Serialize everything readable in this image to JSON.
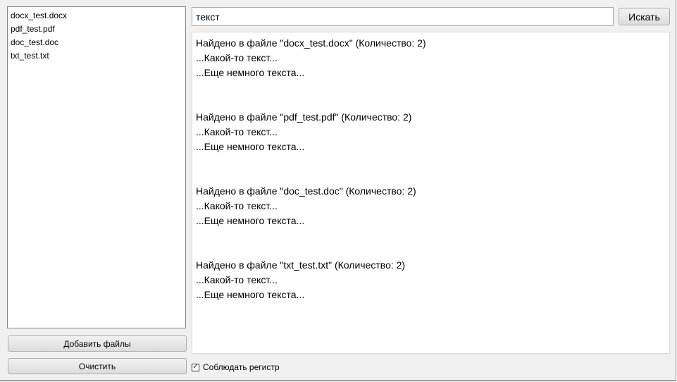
{
  "files": [
    "docx_test.docx",
    "pdf_test.pdf",
    "doc_test.doc",
    "txt_test.txt"
  ],
  "buttons": {
    "add_files": "Добавить файлы",
    "clear": "Очистить",
    "search": "Искать"
  },
  "search": {
    "value": "текст"
  },
  "case_checkbox": {
    "label": "Соблюдать регистр",
    "checked": true
  },
  "results": [
    {
      "header": "Найдено в файле \"docx_test.docx\" (Количество: 2)",
      "lines": [
        "...Какой-то текст...",
        "...Еще немного текста..."
      ]
    },
    {
      "header": "Найдено в файле \"pdf_test.pdf\" (Количество: 2)",
      "lines": [
        "...Какой-то текст...",
        "...Еще немного текста..."
      ]
    },
    {
      "header": "Найдено в файле \"doc_test.doc\" (Количество: 2)",
      "lines": [
        "...Какой-то текст...",
        "...Еще немного текста..."
      ]
    },
    {
      "header": "Найдено в файле \"txt_test.txt\" (Количество: 2)",
      "lines": [
        "...Какой-то текст...",
        "...Еще немного текста..."
      ]
    }
  ]
}
